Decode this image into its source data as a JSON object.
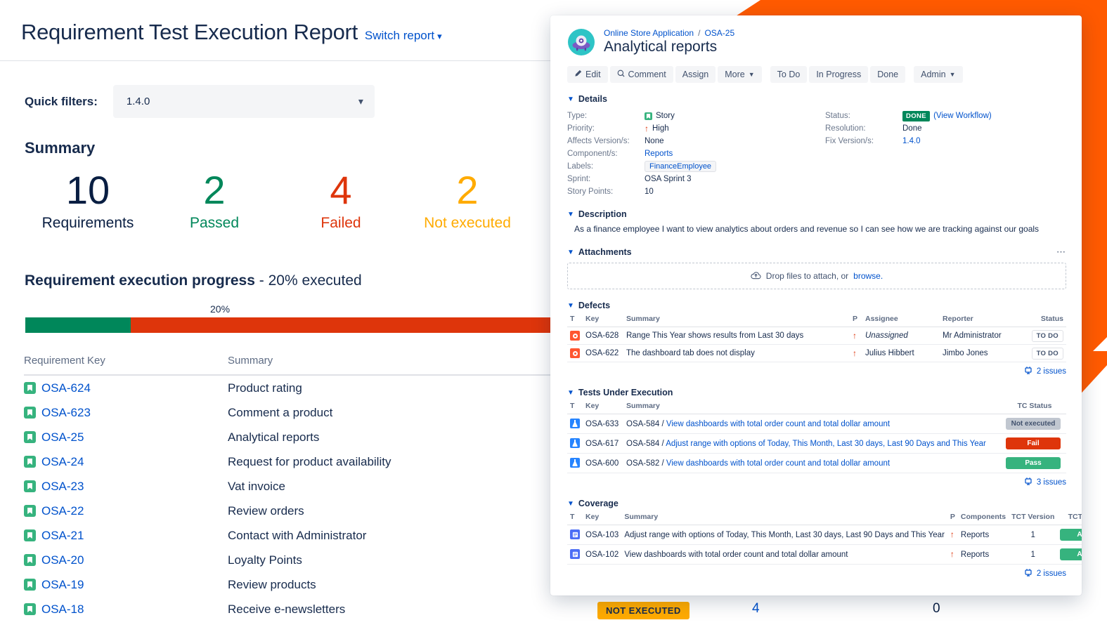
{
  "report": {
    "title": "Requirement Test Execution Report",
    "switch_report": "Switch report",
    "quick_filters_label": "Quick filters:",
    "quick_filter_value": "1.4.0",
    "summary_heading": "Summary",
    "stats": [
      {
        "value": "10",
        "label": "Requirements",
        "color": "#091E42"
      },
      {
        "value": "2",
        "label": "Passed",
        "color": "#00875A"
      },
      {
        "value": "4",
        "label": "Failed",
        "color": "#DE350B"
      },
      {
        "value": "2",
        "label": "Not executed",
        "color": "#FFAB00"
      }
    ],
    "progress_title": "Requirement execution progress",
    "progress_suffix": " - 20% executed",
    "progress_tick_label": "20%",
    "progress_percent": 20,
    "table": {
      "columns": [
        "Requirement Key",
        "Summary"
      ],
      "rows": [
        {
          "key": "OSA-624",
          "summary": "Product rating"
        },
        {
          "key": "OSA-623",
          "summary": "Comment a product"
        },
        {
          "key": "OSA-25",
          "summary": "Analytical reports"
        },
        {
          "key": "OSA-24",
          "summary": "Request for product availability"
        },
        {
          "key": "OSA-23",
          "summary": "Vat invoice"
        },
        {
          "key": "OSA-22",
          "summary": "Review orders"
        },
        {
          "key": "OSA-21",
          "summary": "Contact with Administrator"
        },
        {
          "key": "OSA-20",
          "summary": "Loyalty Points"
        },
        {
          "key": "OSA-19",
          "summary": "Review products"
        },
        {
          "key": "OSA-18",
          "summary": "Receive e-newsletters"
        }
      ]
    },
    "bottom_row": {
      "badge": "NOT EXECUTED",
      "value_1": "4",
      "value_2": "0"
    }
  },
  "panel": {
    "breadcrumb_project": "Online Store Application",
    "breadcrumb_sep": "/",
    "breadcrumb_key": "OSA-25",
    "issue_title": "Analytical reports",
    "buttons": [
      {
        "label": "Edit",
        "icon": "pencil-icon"
      },
      {
        "label": "Comment",
        "icon": "comment-icon"
      },
      {
        "label": "Assign",
        "icon": ""
      },
      {
        "label": "More",
        "icon": "chevron-down-icon"
      },
      {
        "label": "To Do",
        "icon": ""
      },
      {
        "label": "In Progress",
        "icon": ""
      },
      {
        "label": "Done",
        "icon": ""
      },
      {
        "label": "Admin",
        "icon": "chevron-down-icon"
      }
    ],
    "details": {
      "heading": "Details",
      "left": [
        {
          "label": "Type:",
          "value": "Story"
        },
        {
          "label": "Priority:",
          "value": "High"
        },
        {
          "label": "Affects Version/s:",
          "value": "None"
        },
        {
          "label": "Component/s:",
          "value": "Reports"
        },
        {
          "label": "Labels:",
          "value": "FinanceEmployee"
        },
        {
          "label": "Sprint:",
          "value": "OSA Sprint 3"
        },
        {
          "label": "Story Points:",
          "value": "10"
        }
      ],
      "right": [
        {
          "label": "Status:",
          "value": "DONE",
          "extra": "(View Workflow)"
        },
        {
          "label": "Resolution:",
          "value": "Done"
        },
        {
          "label": "Fix Version/s:",
          "value": "1.4.0"
        }
      ]
    },
    "description": {
      "heading": "Description",
      "text": "As a finance employee I want to view analytics about orders and revenue so I can see how we are tracking against our goals"
    },
    "attachments": {
      "heading": "Attachments",
      "drop_text": "Drop files to attach, or",
      "browse_text": "browse."
    },
    "defects": {
      "heading": "Defects",
      "columns": [
        "T",
        "Key",
        "Summary",
        "P",
        "Assignee",
        "Reporter",
        "Status"
      ],
      "rows": [
        {
          "key": "OSA-628",
          "summary": "Range This Year shows results from Last 30 days",
          "assignee": "Unassigned",
          "assignee_italic": true,
          "reporter": "Mr Administrator",
          "status": "TO DO"
        },
        {
          "key": "OSA-622",
          "summary": "The dashboard tab does not display",
          "assignee": "Julius Hibbert",
          "assignee_italic": false,
          "reporter": "Jimbo Jones",
          "status": "TO DO"
        }
      ],
      "issues_link": "2 issues"
    },
    "tests": {
      "heading": "Tests Under Execution",
      "columns": [
        "T",
        "Key",
        "Summary",
        "TC Status"
      ],
      "rows": [
        {
          "key": "OSA-633",
          "parent": "OSA-584 /",
          "summary": "View dashboards with total order count and total dollar amount",
          "status": "Not executed",
          "status_style": "notexec"
        },
        {
          "key": "OSA-617",
          "parent": "OSA-584 /",
          "summary": "Adjust range with options of Today, This Month, Last 30 days, Last 90 Days and This Year",
          "status": "Fail",
          "status_style": "fail"
        },
        {
          "key": "OSA-600",
          "parent": "OSA-582 /",
          "summary": "View dashboards with total order count and total dollar amount",
          "status": "Pass",
          "status_style": "pass"
        }
      ],
      "issues_link": "3 issues"
    },
    "coverage": {
      "heading": "Coverage",
      "columns": [
        "T",
        "Key",
        "Summary",
        "P",
        "Components",
        "TCT Version",
        "TCT Status"
      ],
      "rows": [
        {
          "key": "OSA-103",
          "summary": "Adjust range with options of Today, This Month, Last 30 days, Last 90 Days and This Year",
          "components": "Reports",
          "tct_version": "1",
          "status": "Active"
        },
        {
          "key": "OSA-102",
          "summary": "View dashboards with total order count and total dollar amount",
          "components": "Reports",
          "tct_version": "1",
          "status": "Active"
        }
      ],
      "issues_link": "2 issues"
    }
  },
  "colors": {
    "accent_orange": "#FF5A00",
    "link_blue": "#0052CC",
    "pass_green": "#00875A",
    "fail_red": "#DE350B",
    "amber": "#FFAB00",
    "text_dark": "#172B4D"
  }
}
